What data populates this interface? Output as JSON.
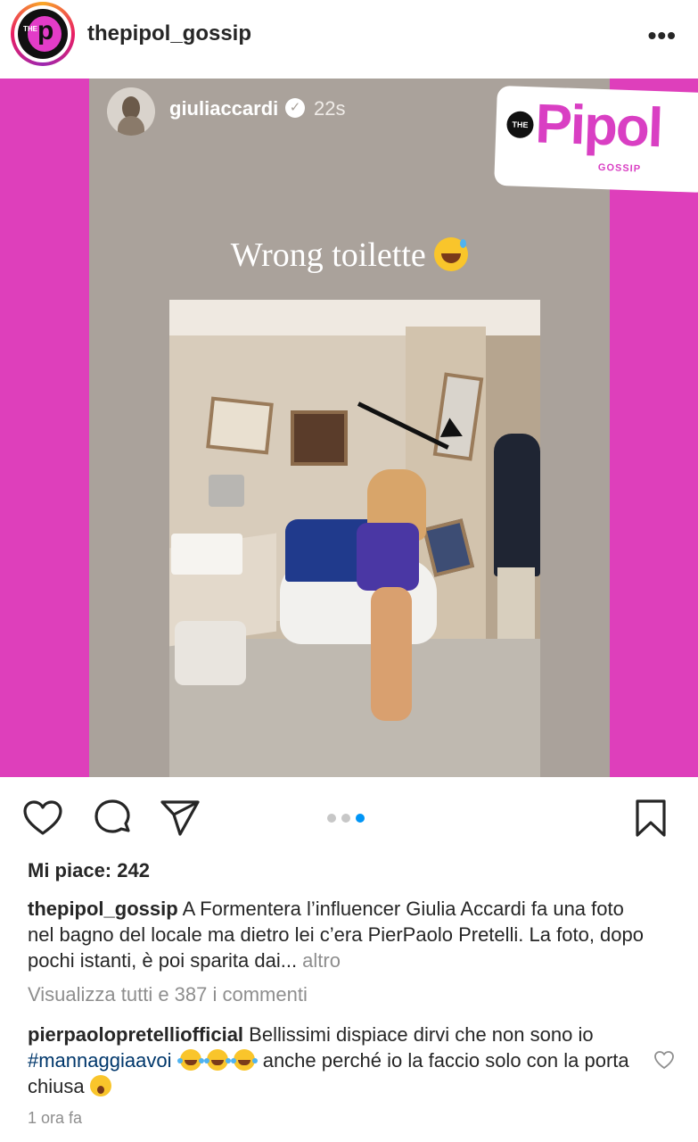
{
  "post": {
    "username": "thepipol_gossip",
    "more_icon": "more-horizontal-icon"
  },
  "story": {
    "username": "giuliaccardi",
    "time": "22s",
    "caption": "Wrong toilette",
    "caption_emoji": "grinning-sweat-emoji"
  },
  "brand": {
    "the": "THE",
    "name": "Pipol",
    "sub": "GOSSIP"
  },
  "carousel": {
    "count": 3,
    "active": 3
  },
  "likes": "Mi piace: 242",
  "caption": {
    "username": "thepipol_gossip",
    "text": " A Formentera l’influencer Giulia Accardi fa una foto nel bagno del locale ma dietro lei c’era PierPaolo Pretelli. La foto, dopo pochi istanti, è poi sparita dai...",
    "more": " altro"
  },
  "view_all_comments": "Visualizza tutti e 387 i commenti",
  "comment": {
    "username": "pierpaolopretelliofficial",
    "text_before": " Bellissimi dispiace dirvi che non sono io ",
    "hashtag": "#mannaggiaavoi",
    "text_after": " anche perché io la faccio solo con la porta chiusa "
  },
  "timestamp": "1 ora fa",
  "colors": {
    "brand_pink": "#de3fbb",
    "link_blue": "#0095f6",
    "hashtag": "#00376b",
    "muted": "#8e8e8e"
  }
}
